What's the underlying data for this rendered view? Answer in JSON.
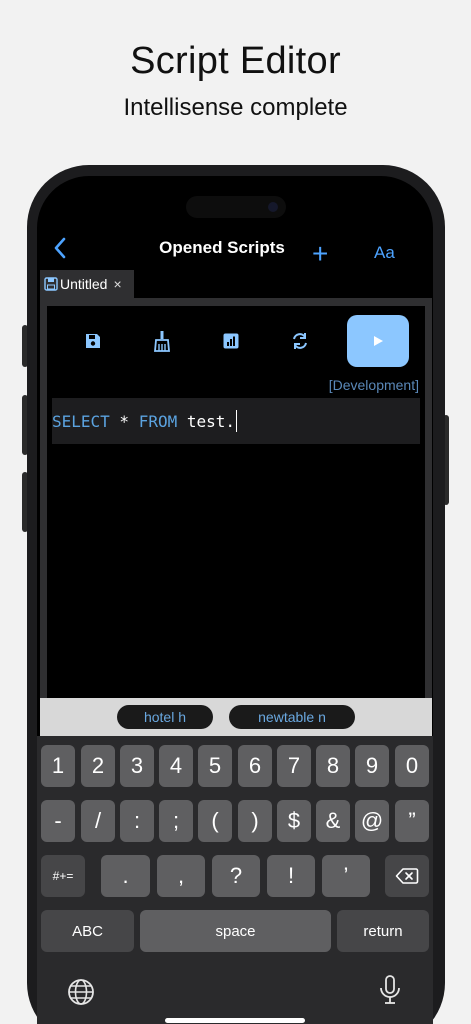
{
  "promo": {
    "title": "Script Editor",
    "subtitle": "Intellisense complete"
  },
  "nav": {
    "title": "Opened Scripts",
    "add_label": "+",
    "font_label": "Aa",
    "back_icon": "chevron-left-icon"
  },
  "tab": {
    "label": "Untitled",
    "close_label": "×"
  },
  "toolbar": {
    "icons": [
      "save-icon",
      "broom-icon",
      "chart-icon",
      "refresh-icon",
      "play-icon"
    ]
  },
  "environment": "[Development]",
  "editor": {
    "kw1": "SELECT",
    "mid": " * ",
    "kw2": "FROM",
    "rest": " test."
  },
  "suggestions": [
    "hotel h",
    "newtable n"
  ],
  "keyboard": {
    "row1": [
      "1",
      "2",
      "3",
      "4",
      "5",
      "6",
      "7",
      "8",
      "9",
      "0"
    ],
    "row2": [
      "-",
      "/",
      ":",
      ";",
      "(",
      ")",
      "$",
      "&",
      "@",
      "”"
    ],
    "row3_left": "#+=",
    "row3": [
      ".",
      ",",
      "?",
      "!",
      "’"
    ],
    "abc": "ABC",
    "space": "space",
    "return": "return"
  },
  "colors": {
    "accent": "#4da3ff",
    "run_button": "#8cc7ff",
    "keyword": "#5ba3e0"
  }
}
